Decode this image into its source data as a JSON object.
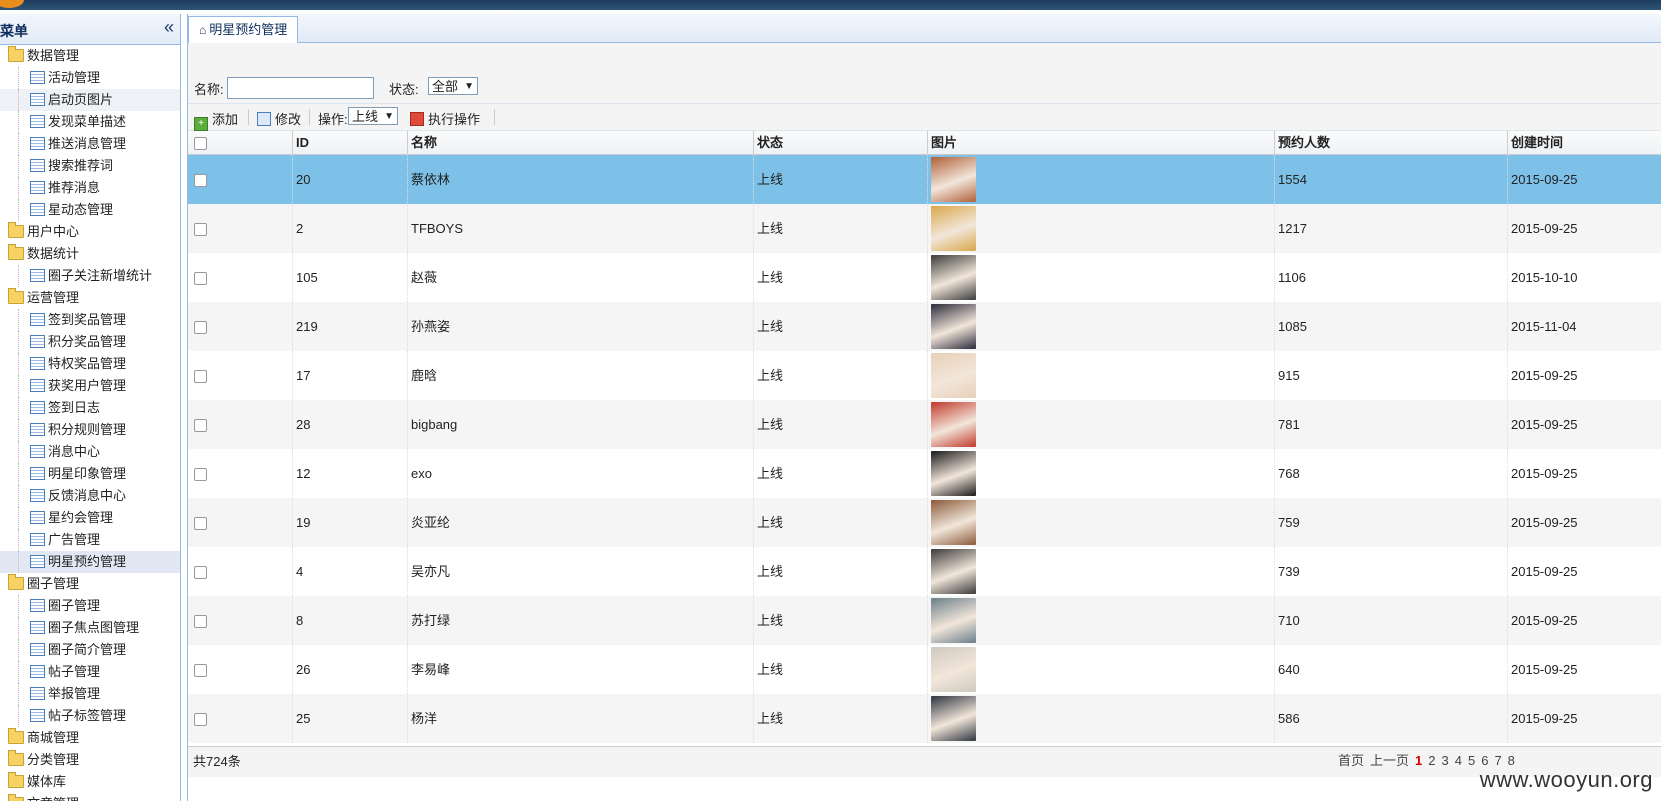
{
  "sidebar": {
    "title": "菜单",
    "collapse_icon": "double-chevron-left-icon",
    "items": [
      {
        "type": "group",
        "label": "数据管理"
      },
      {
        "type": "leaf",
        "label": "活动管理"
      },
      {
        "type": "leaf",
        "label": "启动页图片",
        "state": "hover"
      },
      {
        "type": "leaf",
        "label": "发现菜单描述"
      },
      {
        "type": "leaf",
        "label": "推送消息管理"
      },
      {
        "type": "leaf",
        "label": "搜索推荐词"
      },
      {
        "type": "leaf",
        "label": "推荐消息"
      },
      {
        "type": "leaf",
        "label": "星动态管理"
      },
      {
        "type": "group",
        "label": "用户中心"
      },
      {
        "type": "group",
        "label": "数据统计"
      },
      {
        "type": "leaf",
        "label": "圈子关注新增统计"
      },
      {
        "type": "group",
        "label": "运营管理"
      },
      {
        "type": "leaf",
        "label": "签到奖品管理"
      },
      {
        "type": "leaf",
        "label": "积分奖品管理"
      },
      {
        "type": "leaf",
        "label": "特权奖品管理"
      },
      {
        "type": "leaf",
        "label": "获奖用户管理"
      },
      {
        "type": "leaf",
        "label": "签到日志"
      },
      {
        "type": "leaf",
        "label": "积分规则管理"
      },
      {
        "type": "leaf",
        "label": "消息中心"
      },
      {
        "type": "leaf",
        "label": "明星印象管理"
      },
      {
        "type": "leaf",
        "label": "反馈消息中心"
      },
      {
        "type": "leaf",
        "label": "星约会管理"
      },
      {
        "type": "leaf",
        "label": "广告管理"
      },
      {
        "type": "leaf",
        "label": "明星预约管理",
        "state": "selected"
      },
      {
        "type": "group",
        "label": "圈子管理"
      },
      {
        "type": "leaf",
        "label": "圈子管理"
      },
      {
        "type": "leaf",
        "label": "圈子焦点图管理"
      },
      {
        "type": "leaf",
        "label": "圈子简介管理"
      },
      {
        "type": "leaf",
        "label": "帖子管理"
      },
      {
        "type": "leaf",
        "label": "举报管理"
      },
      {
        "type": "leaf",
        "label": "帖子标签管理"
      },
      {
        "type": "group",
        "label": "商城管理"
      },
      {
        "type": "group",
        "label": "分类管理"
      },
      {
        "type": "group",
        "label": "媒体库"
      },
      {
        "type": "group",
        "label": "文章管理"
      }
    ]
  },
  "tab": {
    "label": "明星预约管理",
    "icon": "home-icon"
  },
  "search": {
    "name_label": "名称:",
    "name_value": "",
    "status_label": "状态:",
    "status_value": "全部"
  },
  "toolbar": {
    "add_label": "添加",
    "edit_label": "修改",
    "op_label": "操作:",
    "op_value": "上线",
    "exec_label": "执行操作"
  },
  "grid": {
    "columns": [
      "",
      "ID",
      "名称",
      "状态",
      "图片",
      "预约人数",
      "创建时间"
    ],
    "rows": [
      {
        "id": "20",
        "name": "蔡依林",
        "status": "上线",
        "count": "1554",
        "created": "2015-09-25",
        "color": "#b0603a"
      },
      {
        "id": "2",
        "name": "TFBOYS",
        "status": "上线",
        "count": "1217",
        "created": "2015-09-25",
        "color": "#d9a84a"
      },
      {
        "id": "105",
        "name": "赵薇",
        "status": "上线",
        "count": "1106",
        "created": "2015-10-10",
        "color": "#3b3b3b"
      },
      {
        "id": "219",
        "name": "孙燕姿",
        "status": "上线",
        "count": "1085",
        "created": "2015-11-04",
        "color": "#2a2a3a"
      },
      {
        "id": "17",
        "name": "鹿晗",
        "status": "上线",
        "count": "915",
        "created": "2015-09-25",
        "color": "#e8d0b8"
      },
      {
        "id": "28",
        "name": "bigbang",
        "status": "上线",
        "count": "781",
        "created": "2015-09-25",
        "color": "#c0392b"
      },
      {
        "id": "12",
        "name": "exo",
        "status": "上线",
        "count": "768",
        "created": "2015-09-25",
        "color": "#1a1a1a"
      },
      {
        "id": "19",
        "name": "炎亚纶",
        "status": "上线",
        "count": "759",
        "created": "2015-09-25",
        "color": "#8a5a3a"
      },
      {
        "id": "4",
        "name": "吴亦凡",
        "status": "上线",
        "count": "739",
        "created": "2015-09-25",
        "color": "#3a3a3a"
      },
      {
        "id": "8",
        "name": "苏打绿",
        "status": "上线",
        "count": "710",
        "created": "2015-09-25",
        "color": "#6a7f8a"
      },
      {
        "id": "26",
        "name": "李易峰",
        "status": "上线",
        "count": "640",
        "created": "2015-09-25",
        "color": "#cfc8c0"
      },
      {
        "id": "25",
        "name": "杨洋",
        "status": "上线",
        "count": "586",
        "created": "2015-09-25",
        "color": "#2e3440"
      }
    ]
  },
  "footer": {
    "total": "共724条",
    "pager_first": "首页",
    "pager_prev": "上一页",
    "pages": [
      "1",
      "2",
      "3",
      "4",
      "5",
      "6",
      "7",
      "8"
    ],
    "current_page": "1"
  },
  "watermark": "www.wooyun.org"
}
